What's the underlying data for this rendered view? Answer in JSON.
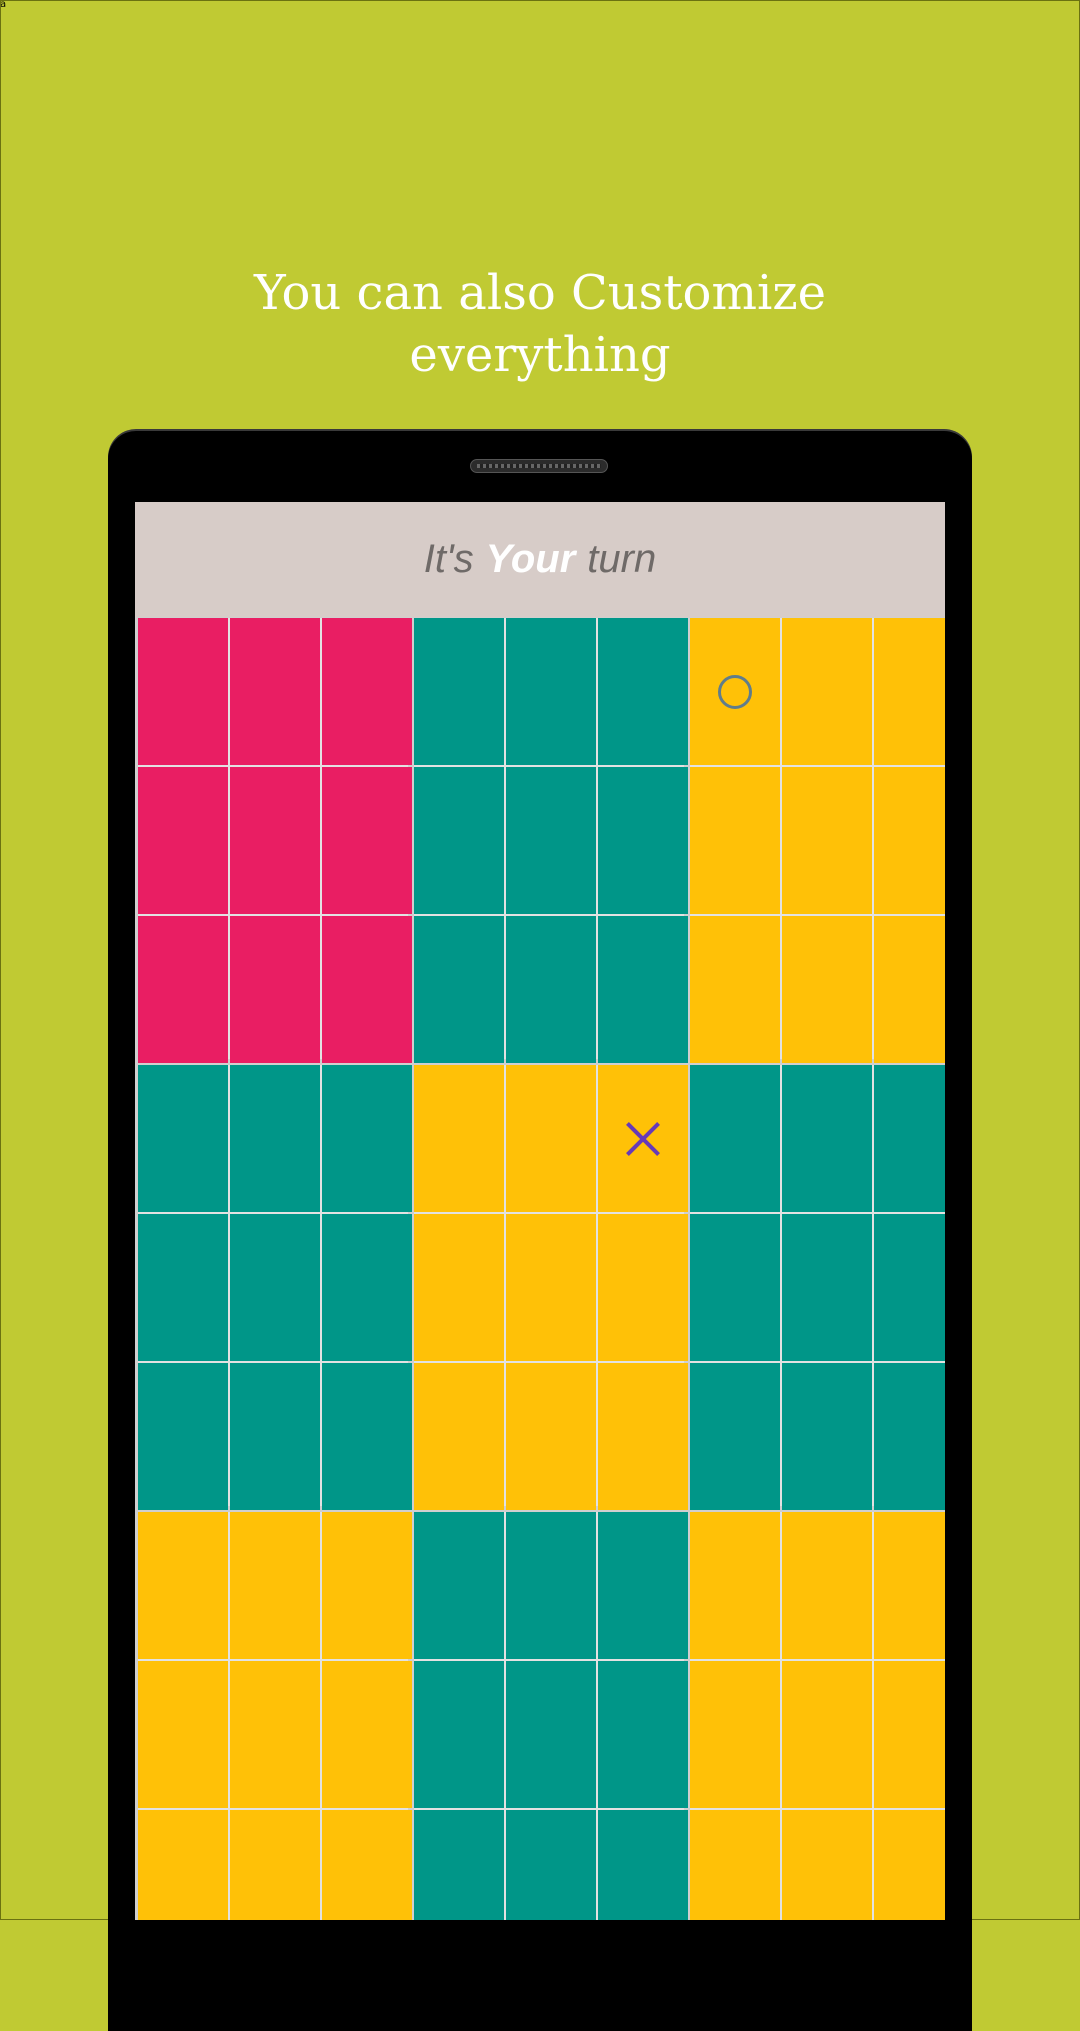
{
  "corner_label": "a",
  "promo": {
    "title_line1": "You can also Customize",
    "title_line2": "everything"
  },
  "status_bar": {
    "prefix": "It's",
    "emphasis": "Your",
    "suffix": "turn"
  },
  "colors": {
    "background": "#c0ca33",
    "pink": "#e91e63",
    "teal": "#009688",
    "amber": "#ffc107",
    "o_mark": "#607d8b",
    "x_mark": "#673ab7",
    "status_bar": "#d7ccc8"
  },
  "board": {
    "mini_boards": [
      {
        "color": "pink",
        "marks": [
          "",
          "",
          "",
          "",
          "",
          "",
          "",
          "",
          ""
        ]
      },
      {
        "color": "teal",
        "marks": [
          "",
          "",
          "",
          "",
          "",
          "",
          "",
          "",
          ""
        ]
      },
      {
        "color": "amber",
        "marks": [
          "O",
          "",
          "",
          "",
          "",
          "",
          "",
          "",
          ""
        ]
      },
      {
        "color": "teal",
        "marks": [
          "",
          "",
          "",
          "",
          "",
          "",
          "",
          "",
          ""
        ]
      },
      {
        "color": "amber",
        "marks": [
          "",
          "",
          "X",
          "",
          "",
          "",
          "",
          "",
          ""
        ]
      },
      {
        "color": "teal",
        "marks": [
          "",
          "",
          "",
          "",
          "",
          "",
          "",
          "",
          ""
        ]
      },
      {
        "color": "amber",
        "marks": [
          "",
          "",
          "",
          "",
          "",
          "",
          "",
          "",
          ""
        ]
      },
      {
        "color": "teal",
        "marks": [
          "",
          "",
          "",
          "",
          "",
          "",
          "",
          "",
          ""
        ]
      },
      {
        "color": "amber",
        "marks": [
          "",
          "",
          "",
          "",
          "",
          "",
          "",
          "",
          ""
        ]
      }
    ]
  }
}
